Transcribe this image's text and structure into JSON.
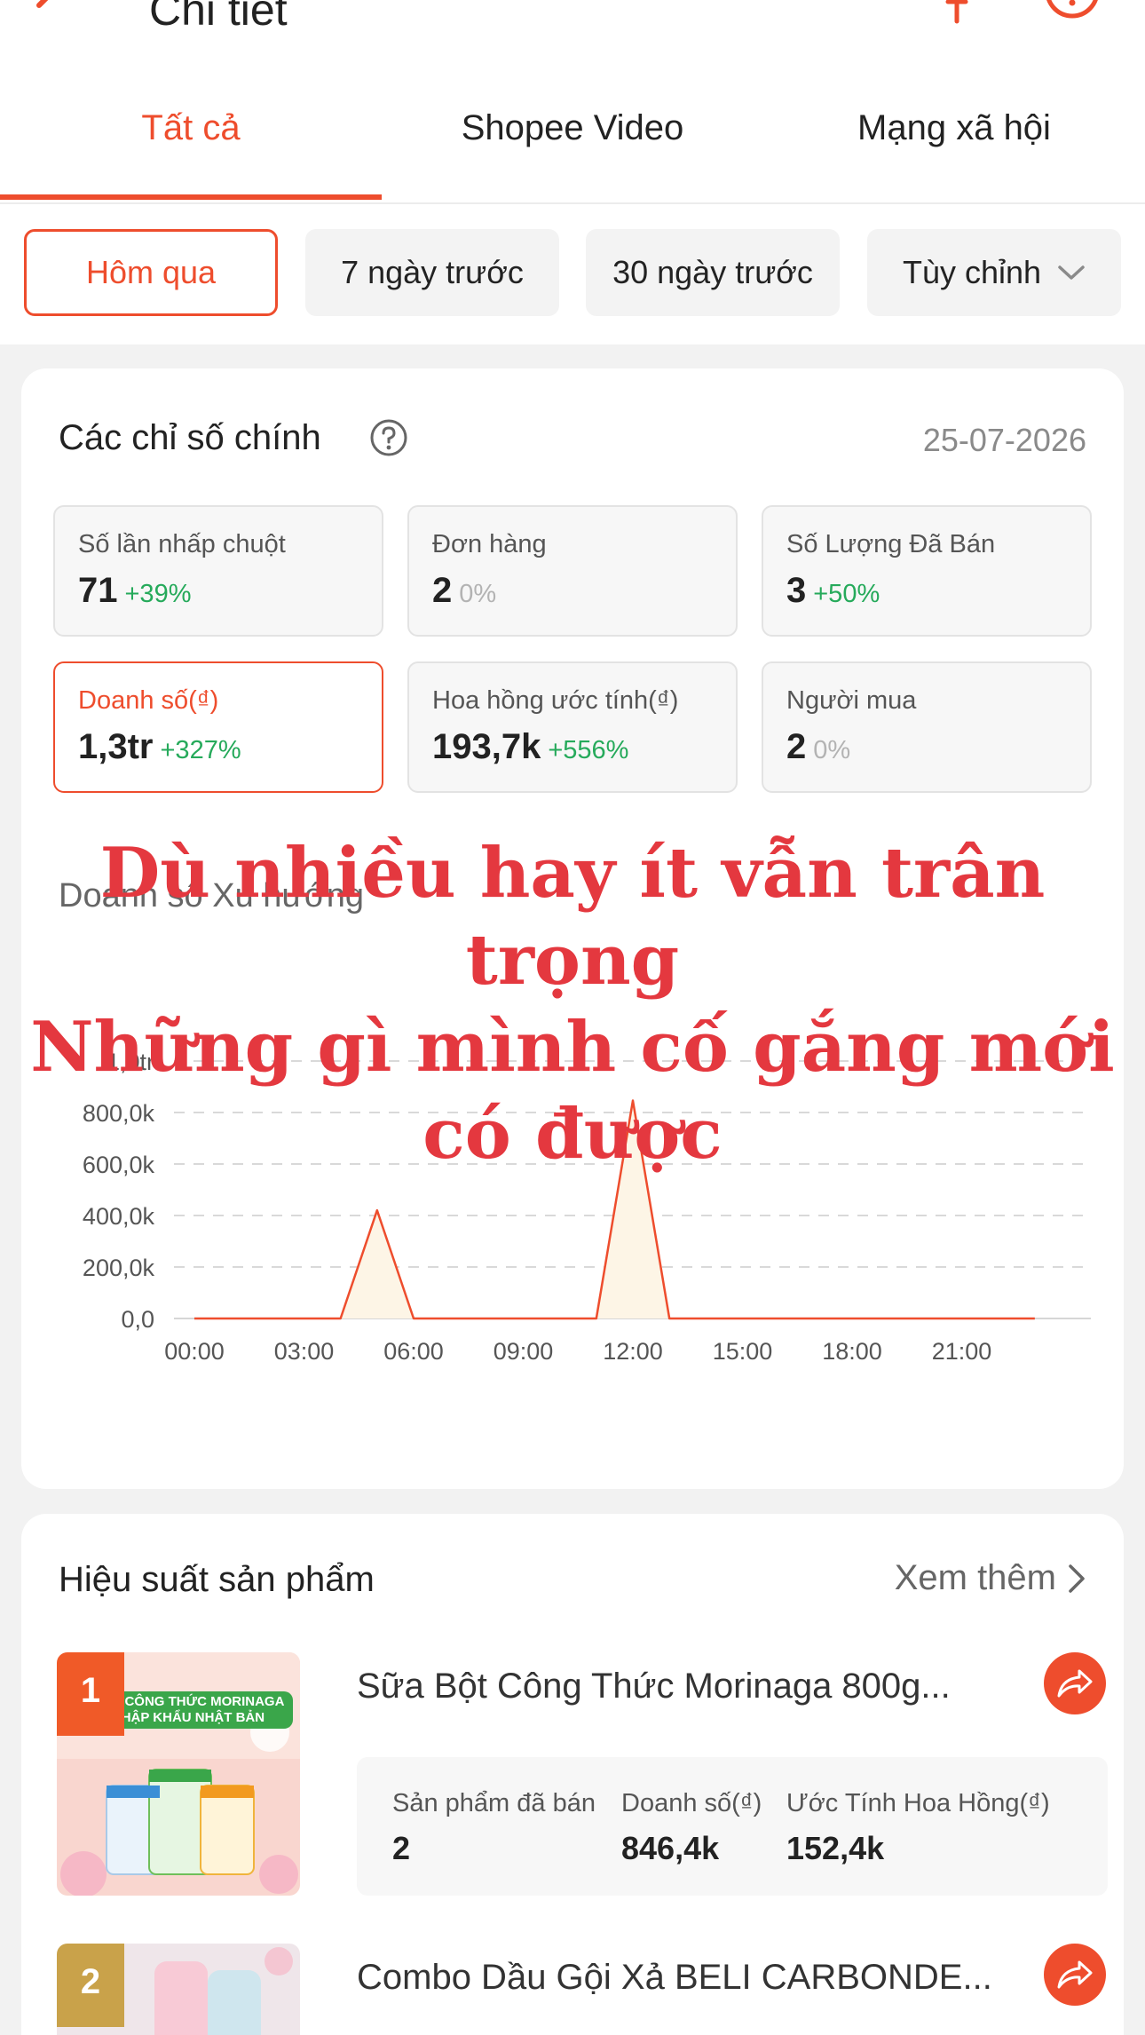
{
  "header": {
    "title": "Chi tiết"
  },
  "tabs": [
    {
      "label": "Tất cả"
    },
    {
      "label": "Shopee Video"
    },
    {
      "label": "Mạng xã hội"
    }
  ],
  "filters": [
    {
      "label": "Hôm qua"
    },
    {
      "label": "7 ngày trước"
    },
    {
      "label": "30 ngày trước"
    },
    {
      "label": "Tùy chỉnh"
    }
  ],
  "key_metrics": {
    "title": "Các chỉ số chính",
    "date": "25-07-2026",
    "items": [
      {
        "label": "Số lần nhấp chuột",
        "value": "71",
        "change": "+39%"
      },
      {
        "label": "Đơn hàng",
        "value": "2",
        "change": "0%"
      },
      {
        "label": "Số Lượng Đã Bán",
        "value": "3",
        "change": "+50%"
      },
      {
        "label": "Doanh số(₫)",
        "value": "1,3tr",
        "change": "+327%"
      },
      {
        "label": "Hoa hồng ước tính(₫)",
        "value": "193,7k",
        "change": "+556%"
      },
      {
        "label": "Người mua",
        "value": "2",
        "change": "0%"
      }
    ]
  },
  "chart_title": "Doanh số Xu hướng",
  "chart_data": {
    "type": "area",
    "title": "Doanh số Xu hướng",
    "y_tick_labels": [
      "0,0",
      "200,0k",
      "400,0k",
      "600,0k",
      "800,0k",
      "1,0tr"
    ],
    "x_tick_labels": [
      "00:00",
      "03:00",
      "06:00",
      "09:00",
      "12:00",
      "15:00",
      "18:00",
      "21:00"
    ],
    "ylim": [
      0,
      1000000
    ],
    "x_hours": [
      0,
      4,
      5,
      6,
      11,
      12,
      13,
      23
    ],
    "values": [
      0,
      0,
      420000,
      0,
      0,
      846400,
      0,
      0
    ],
    "grid": true
  },
  "overlay_text": {
    "line1": "Dù nhiều hay ít vẫn trân",
    "line2": "trọng",
    "line3": "Những gì mình cố gắng mới",
    "line4": "có được"
  },
  "products_section": {
    "title": "Hiệu suất sản phẩm",
    "more_label": "Xem thêm",
    "stat_headers": [
      "Sản phẩm đã bán",
      "Doanh số(₫)",
      "Ước Tính Hoa Hồng(₫)"
    ],
    "items": [
      {
        "rank": "1",
        "name": "Sữa Bột Công Thức Morinaga 800g...",
        "image_text": "SỮA CÔNG THỨC MORINAGA NHẬP KHẨU NHẬT BẢN",
        "sold": "2",
        "revenue": "846,4k",
        "commission": "152,4k"
      },
      {
        "rank": "2",
        "name": "Combo Dầu Gội Xả BELI CARBONDE..."
      }
    ]
  },
  "colors": {
    "accent": "#ee4d2d",
    "positive": "#26aa5b",
    "overlay": "#e4383f",
    "rank1": "#f05a28",
    "rank2": "#c9a24a"
  }
}
